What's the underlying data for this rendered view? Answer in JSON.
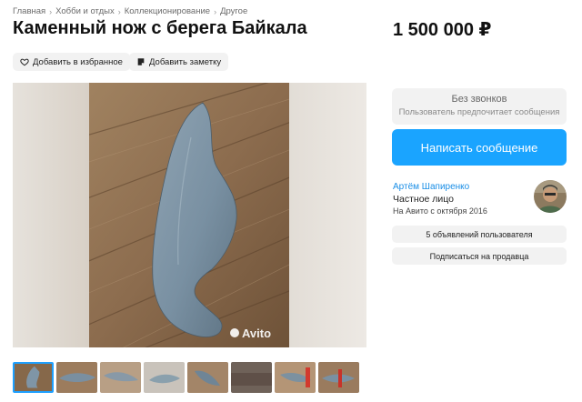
{
  "breadcrumbs": [
    "Главная",
    "Хобби и отдых",
    "Коллекционирование",
    "Другое"
  ],
  "breadcrumb_separator": "›",
  "title": "Каменный нож с берега Байкала",
  "price": "1 500 000 ₽",
  "actions": {
    "favorite_label": "Добавить в избранное",
    "note_label": "Добавить заметку"
  },
  "photo": {
    "watermark": "Avito",
    "thumbnail_count": 8,
    "selected_index": 0
  },
  "contact": {
    "no_calls_title": "Без звонков",
    "no_calls_subtitle": "Пользователь предпочитает сообщения",
    "message_button": "Написать сообщение"
  },
  "seller": {
    "name": "Артём Шапиренко",
    "type": "Частное лицо",
    "since": "На Авито с октября 2016",
    "ads_button": "5 объявлений пользователя",
    "subscribe_button": "Подписаться на продавца"
  },
  "colors": {
    "accent": "#1aa4ff",
    "link": "#1a8ee6",
    "thumb_selected": "#1ea0ff"
  },
  "icons": {
    "favorite": "heart-icon",
    "note": "note-icon"
  }
}
